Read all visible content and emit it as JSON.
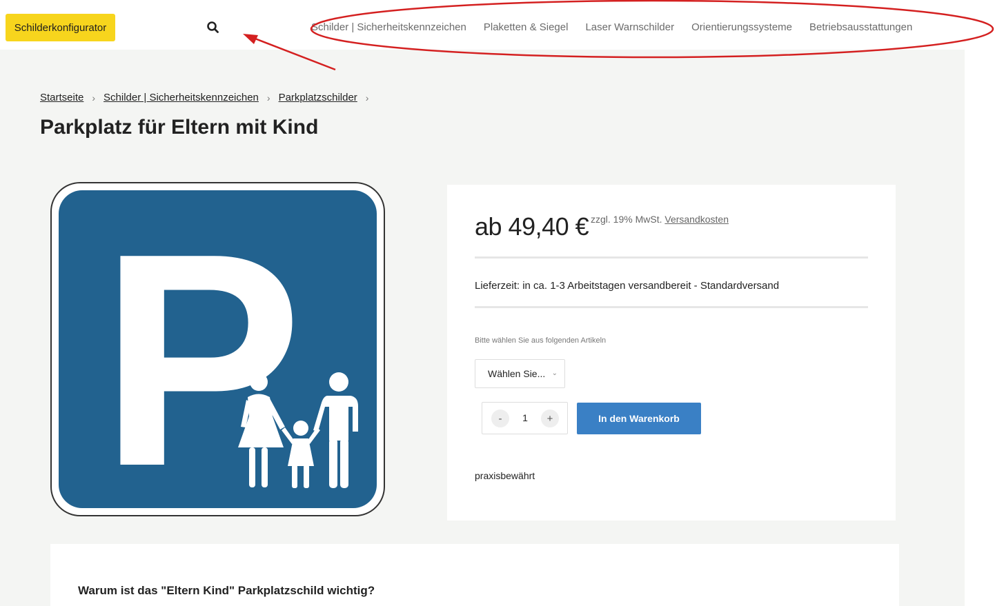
{
  "header": {
    "configurator_label": "Schilderkonfigurator",
    "nav": [
      "Schilder | Sicherheitskennzeichen",
      "Plaketten & Siegel",
      "Laser Warnschilder",
      "Orientierungssysteme",
      "Betriebsausstattungen"
    ]
  },
  "breadcrumb": [
    "Startseite",
    "Schilder | Sicherheitskennzeichen",
    "Parkplatzschilder"
  ],
  "product": {
    "title": "Parkplatz für Eltern mit Kind",
    "image_letter": "P",
    "price": "ab 49,40 €",
    "tax_text": "zzgl. 19% MwSt.",
    "shipping_link": "Versandkosten",
    "delivery": "Lieferzeit: in ca. 1-3 Arbeitstagen versandbereit - Standardversand",
    "select_hint": "Bitte wählen Sie aus folgenden Artikeln",
    "select_value": "Wählen Sie...",
    "quantity": "1",
    "qty_minus": "-",
    "qty_plus": "+",
    "cart_label": "In den Warenkorb",
    "tagline": "praxisbewährt"
  },
  "description": {
    "title": "Warum ist das \"Eltern Kind\" Parkplatzschild wichtig?"
  },
  "colors": {
    "accent_yellow": "#f7d51d",
    "button_blue": "#3a80c5",
    "sign_blue": "#22628f",
    "annotation_red": "#d42020"
  }
}
